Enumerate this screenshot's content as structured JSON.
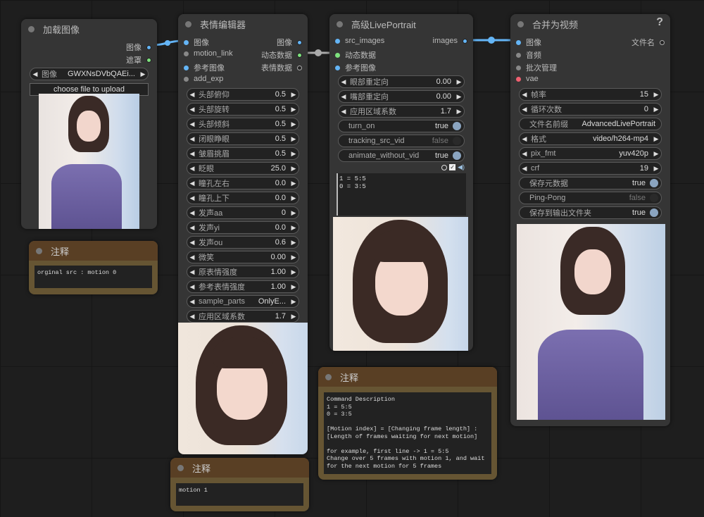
{
  "nodes": {
    "load_image": {
      "title": "加载图像",
      "outputs": [
        "图像",
        "遮罩"
      ],
      "image_widget": {
        "label": "图像",
        "value": "GWXNsDVbQAEi..."
      },
      "upload_label": "choose file to upload"
    },
    "expression_editor": {
      "title": "表情编辑器",
      "inputs": [
        "图像",
        "motion_link",
        "参考图像",
        "add_exp"
      ],
      "outputs": [
        "图像",
        "动态数据",
        "表情数据"
      ],
      "widgets": [
        {
          "label": "头部俯仰",
          "value": "0.5"
        },
        {
          "label": "头部旋转",
          "value": "0.5"
        },
        {
          "label": "头部倾斜",
          "value": "0.5"
        },
        {
          "label": "闭眼睁眼",
          "value": "0.5"
        },
        {
          "label": "皱眉挑眉",
          "value": "0.5"
        },
        {
          "label": "眨眼",
          "value": "25.0"
        },
        {
          "label": "瞳孔左右",
          "value": "0.0"
        },
        {
          "label": "瞳孔上下",
          "value": "0.0"
        },
        {
          "label": "发声aa",
          "value": "0"
        },
        {
          "label": "发声yi",
          "value": "0.0"
        },
        {
          "label": "发声ou",
          "value": "0.6"
        },
        {
          "label": "微笑",
          "value": "0.00"
        },
        {
          "label": "原表情强度",
          "value": "1.00"
        },
        {
          "label": "参考表情强度",
          "value": "1.00"
        },
        {
          "label": "sample_parts",
          "value": "OnlyE..."
        },
        {
          "label": "应用区域系数",
          "value": "1.7"
        }
      ]
    },
    "advanced_live_portrait": {
      "title": "高级LivePortrait",
      "inputs": [
        "src_images",
        "动态数据",
        "参考图像"
      ],
      "outputs": [
        "images"
      ],
      "widgets": [
        {
          "label": "眼部重定向",
          "value": "0.00"
        },
        {
          "label": "嘴部重定向",
          "value": "0.00"
        },
        {
          "label": "应用区域系数",
          "value": "1.7"
        }
      ],
      "toggles": [
        {
          "label": "turn_on",
          "value": "true",
          "on": true
        },
        {
          "label": "tracking_src_vid",
          "value": "false",
          "on": false
        },
        {
          "label": "animate_without_vid",
          "value": "true",
          "on": true
        }
      ],
      "command_text": "1 = 5:5\n0 = 3:5"
    },
    "video_combine": {
      "title": "合并为视频",
      "help": "?",
      "inputs": [
        "图像",
        "音频",
        "批次管理",
        "vae"
      ],
      "outputs": [
        "文件名"
      ],
      "widgets": [
        {
          "label": "帧率",
          "value": "15"
        },
        {
          "label": "循环次数",
          "value": "0"
        }
      ],
      "filename_prefix": {
        "label": "文件名前缀",
        "value": "AdvancedLivePortrait"
      },
      "widgets2": [
        {
          "label": "格式",
          "value": "video/h264-mp4"
        },
        {
          "label": "pix_fmt",
          "value": "yuv420p"
        },
        {
          "label": "crf",
          "value": "19"
        }
      ],
      "toggles": [
        {
          "label": "保存元数据",
          "value": "true",
          "on": true
        },
        {
          "label": "Ping-Pong",
          "value": "false",
          "on": false
        },
        {
          "label": "保存到输出文件夹",
          "value": "true",
          "on": true
        }
      ]
    }
  },
  "notes": [
    {
      "title": "注释",
      "text": "orginal src : motion 0"
    },
    {
      "title": "注释",
      "text": "motion 1"
    },
    {
      "title": "注释",
      "text": "Command Description\n1 = 5:5\n0 = 3:5\n\n[Motion index] = [Changing frame length] : [Length of frames waiting for next motion]\n\nfor example, first line -> 1 = 5:5\nChange over 5 frames with motion 1, and wait for the next motion for 5 frames"
    }
  ],
  "colors": {
    "image_link": "#64b5f6",
    "motion_link": "#aaaaaa",
    "canvas": "#1e1e1e",
    "node": "#353535",
    "note": "#665533"
  }
}
